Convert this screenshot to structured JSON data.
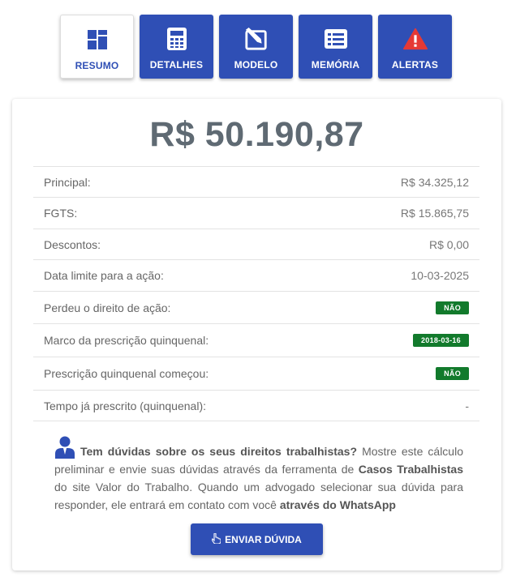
{
  "tabs": [
    {
      "label": "RESUMO",
      "icon": "dashboard-icon",
      "active": true
    },
    {
      "label": "DETALHES",
      "icon": "calculator-icon",
      "active": false
    },
    {
      "label": "MODELO",
      "icon": "edit-icon",
      "active": false
    },
    {
      "label": "MEMÓRIA",
      "icon": "list-icon",
      "active": false
    },
    {
      "label": "ALERTAS",
      "icon": "warning-icon",
      "active": false
    }
  ],
  "summary": {
    "total": "R$ 50.190,87",
    "rows": [
      {
        "label": "Principal:",
        "value": "R$ 34.325,12"
      },
      {
        "label": "FGTS:",
        "value": "R$ 15.865,75"
      },
      {
        "label": "Descontos:",
        "value": "R$ 0,00"
      },
      {
        "label": "Data limite para a ação:",
        "value": "10-03-2025"
      },
      {
        "label": "Perdeu o direito de ação:",
        "badge": "NÃO"
      },
      {
        "label": "Marco da prescrição quinquenal:",
        "badge": "2018-03-16"
      },
      {
        "label": "Prescrição quinquenal começou:",
        "badge": "NÃO"
      },
      {
        "label": "Tempo já prescrito (quinquenal):",
        "value": "-"
      }
    ]
  },
  "info": {
    "question": "Tem dúvidas sobre os seus direitos trabalhistas?",
    "text1": " Mostre este cálculo preliminar e envie suas dúvidas através da ferramenta de ",
    "link": "Casos Trabalhistas",
    "text2": " do site Valor do Trabalho. Quando um advogado selecionar sua dúvida para responder, ele entrará em contato com você ",
    "whatsapp": "através do WhatsApp"
  },
  "button": {
    "label": "ENVIAR DÚVIDA",
    "icon": "hand-pointer-icon"
  },
  "colors": {
    "primary": "#2f4fb5",
    "badge": "#127a2c",
    "alert_icon": "#e53935",
    "total": "#5f6a73"
  }
}
